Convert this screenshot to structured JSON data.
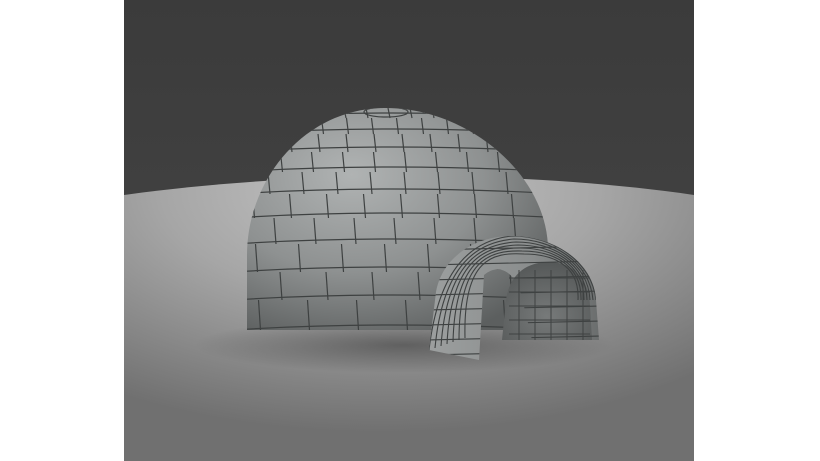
{
  "image": {
    "subject": "igloo-3d-render",
    "colors": {
      "page_background": "#ffffff",
      "backdrop_dark": "#3a3a3a",
      "floor_light": "#bcbcbc",
      "floor_dark": "#6e6e6e",
      "ice_light": "#a6a9a9",
      "ice_dark": "#5f6262",
      "mortar": "#3e4141"
    }
  }
}
